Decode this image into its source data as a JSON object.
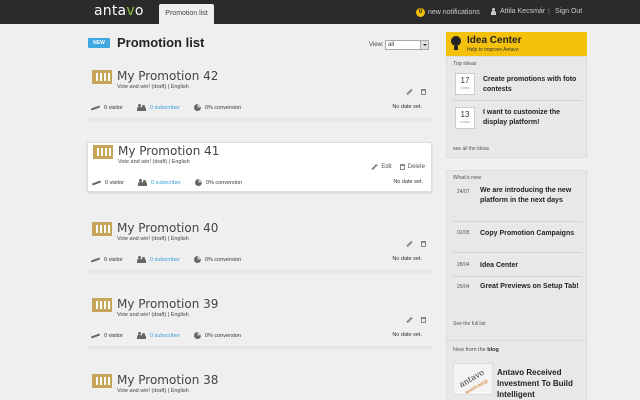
{
  "topbar": {
    "logo": "antavo",
    "active_tab": "Promotion list",
    "notifications_count": "0",
    "notifications_label": "new notifications",
    "user_name": "Attila Kecsmár",
    "separator": "|",
    "sign_out": "Sign Out"
  },
  "header": {
    "new_badge": "NEW",
    "title": "Promotion list",
    "view_label": "View:",
    "view_value": "all"
  },
  "promotions": [
    {
      "name": "My Promotion 42",
      "desc": "Vote and win! (draft) | English",
      "visitors": "0 visitor",
      "subscribers": "0 subscriber",
      "conversion": "0% conversion",
      "date": "No date set."
    },
    {
      "name": "My Promotion 41",
      "desc": "Vote and win! (draft) | English",
      "visitors": "0 visitor",
      "subscribers": "0 subscriber",
      "conversion": "0% conversion",
      "date": "No date set.",
      "edit": "Edit",
      "delete": "Delete"
    },
    {
      "name": "My Promotion 40",
      "desc": "Vote and win! (draft) | English",
      "visitors": "0 visitor",
      "subscribers": "0 subscriber",
      "conversion": "0% conversion",
      "date": "No date set."
    },
    {
      "name": "My Promotion 39",
      "desc": "Vote and win! (draft) | English",
      "visitors": "0 visitor",
      "subscribers": "0 subscriber",
      "conversion": "0% conversion",
      "date": "No date set."
    },
    {
      "name": "My Promotion 38",
      "desc": "Vote and win! (draft) | English"
    }
  ],
  "sidebar": {
    "idea_title": "Idea Center",
    "idea_subtitle": "Help to improve Antavo",
    "top_ideas_title": "Top ideas",
    "ideas": [
      {
        "votes": "17",
        "votes_label": "votes",
        "text": "Create promotions with foto contests"
      },
      {
        "votes": "13",
        "votes_label": "votes",
        "text": "I want to customize the display platform!"
      }
    ],
    "see_all_ideas": "see all the ideas",
    "whats_new_title": "What's new",
    "news": [
      {
        "date": "24/07",
        "text": "We are introducing the new platform in the next days"
      },
      {
        "date": "02/05",
        "text": "Copy Promotion Campaigns"
      },
      {
        "date": "28/04",
        "text": "Idea Center"
      },
      {
        "date": "25/04",
        "text": "Great Previews on Setup Tab!"
      }
    ],
    "see_full_list": "See the full list",
    "blog_label_prefix": "New from the",
    "blog_label_bold": "blog",
    "blog_image_text": "antavo",
    "blog_image_subtext": "seedcamp",
    "blog_text": "Antavo Received Investment To Build Intelligent"
  },
  "colors": {
    "topbar_bg": "#2b2b2b",
    "accent_yellow": "#f4c20d",
    "accent_blue": "#3ea7e0",
    "link_blue": "#3aa0d8",
    "thumb_gold": "#c6a45a"
  }
}
